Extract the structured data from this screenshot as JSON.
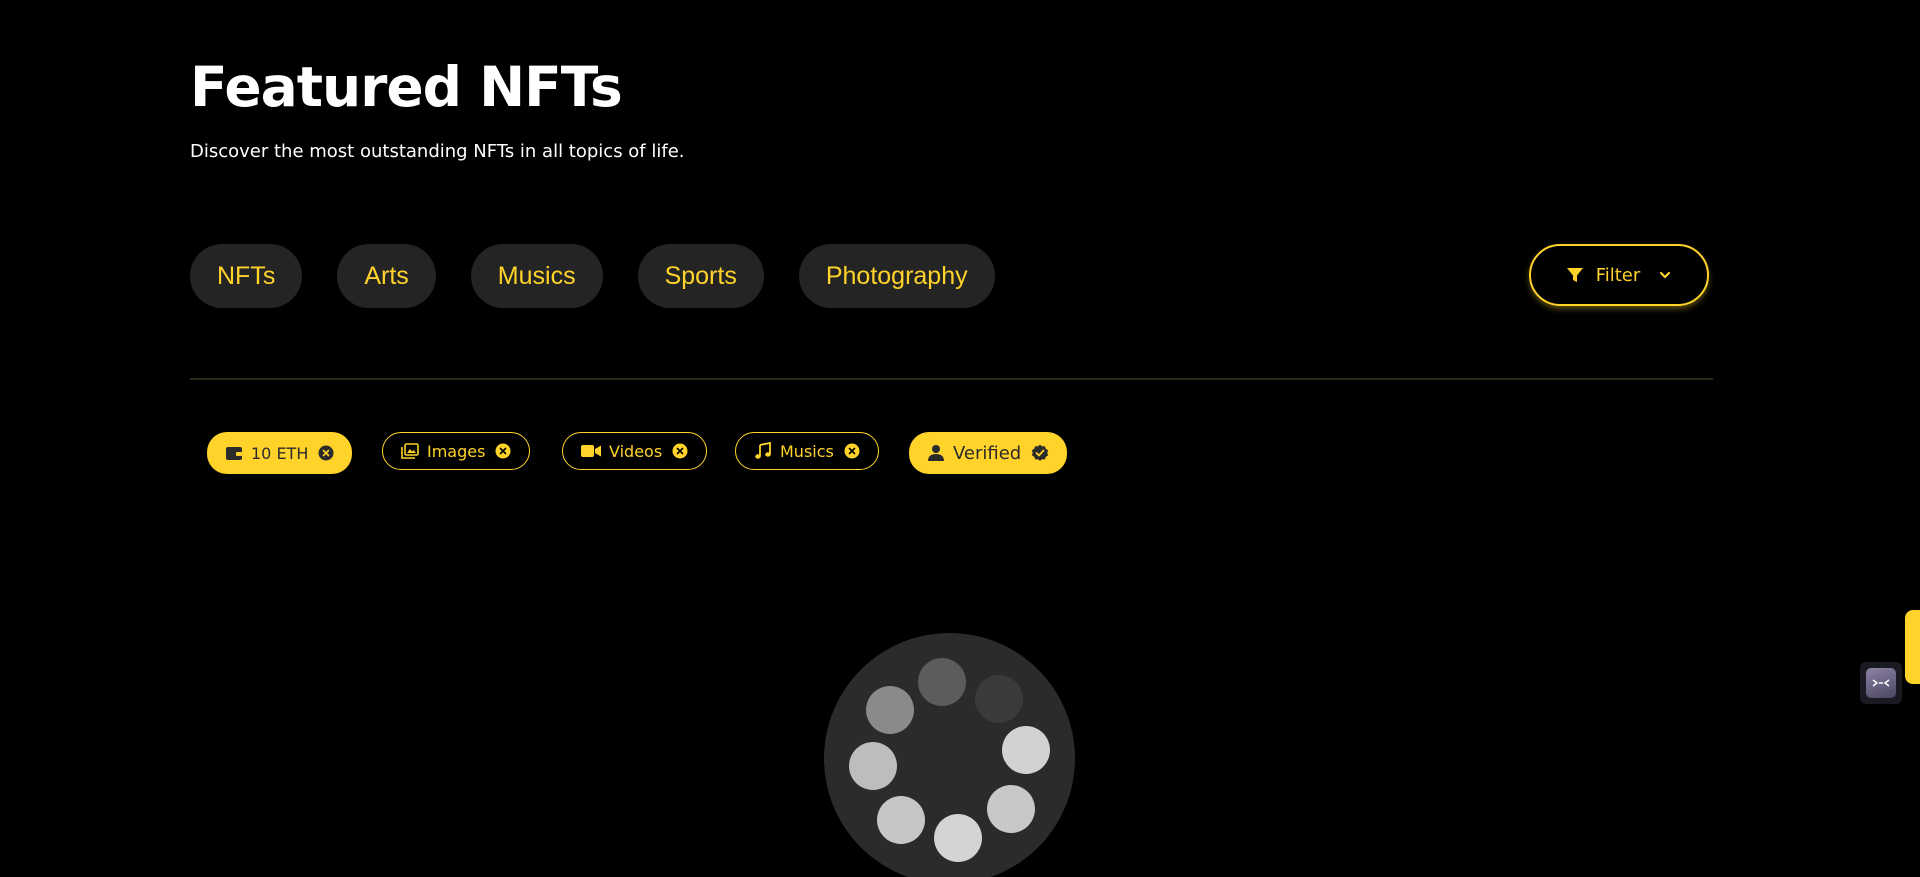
{
  "header": {
    "title": "Featured NFTs",
    "subtitle": "Discover the most outstanding NFTs in all topics of life."
  },
  "tabs": [
    {
      "label": "NFTs"
    },
    {
      "label": "Arts"
    },
    {
      "label": "Musics"
    },
    {
      "label": "Sports"
    },
    {
      "label": "Photography"
    }
  ],
  "filter_button": {
    "label": "Filter",
    "icon": "filter-icon",
    "chevron_icon": "chevron-down-icon"
  },
  "active_filters": [
    {
      "label": "10 ETH",
      "icon": "wallet-icon",
      "style": "filled",
      "remove_icon": "close-circle-icon"
    },
    {
      "label": "Images",
      "icon": "images-icon",
      "style": "outline",
      "remove_icon": "close-circle-icon"
    },
    {
      "label": "Videos",
      "icon": "video-camera-icon",
      "style": "outline",
      "remove_icon": "close-circle-icon"
    },
    {
      "label": "Musics",
      "icon": "music-note-icon",
      "style": "outline",
      "remove_icon": "close-circle-icon"
    },
    {
      "label": "Verified",
      "icon": "user-icon",
      "style": "filled",
      "remove_icon": "verified-check-icon"
    }
  ],
  "colors": {
    "accent": "#ffd32a",
    "background": "#000000",
    "tab_background": "#242424",
    "loader_background": "#2b2b2b"
  },
  "loader": {
    "icon": "loading-spinner-icon"
  },
  "side_widget": {
    "icon": "terminal-icon"
  }
}
